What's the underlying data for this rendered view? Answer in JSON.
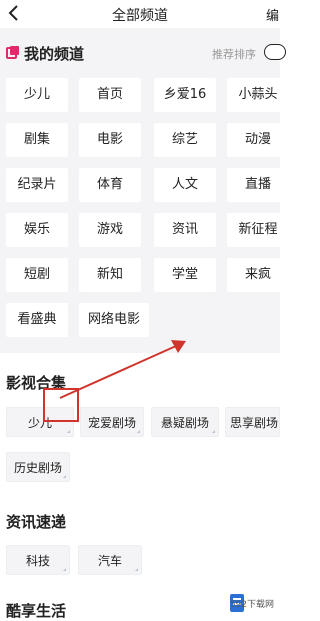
{
  "header": {
    "title": "全部频道",
    "edit_label": "编"
  },
  "my_channels": {
    "title": "我的频道",
    "sort_label": "推荐排序",
    "items": [
      "少儿",
      "首页",
      "乡爱16",
      "小蒜头",
      "剧集",
      "电影",
      "综艺",
      "动漫",
      "纪录片",
      "体育",
      "人文",
      "直播",
      "娱乐",
      "游戏",
      "资讯",
      "新征程",
      "短剧",
      "新知",
      "学堂",
      "来疯",
      "看盛典",
      "网络电影"
    ]
  },
  "film_collection": {
    "title": "影视合集",
    "items": [
      "少儿",
      "宠爱剧场",
      "悬疑剧场",
      "思享剧场",
      "历史剧场"
    ]
  },
  "news": {
    "title": "资讯速递",
    "items": [
      "科技",
      "汽车"
    ]
  },
  "life": {
    "title": "酷享生活"
  },
  "watermark": {
    "text": "592下载网"
  },
  "colors": {
    "accent": "#e02a6d",
    "annotation": "#d0342c"
  }
}
